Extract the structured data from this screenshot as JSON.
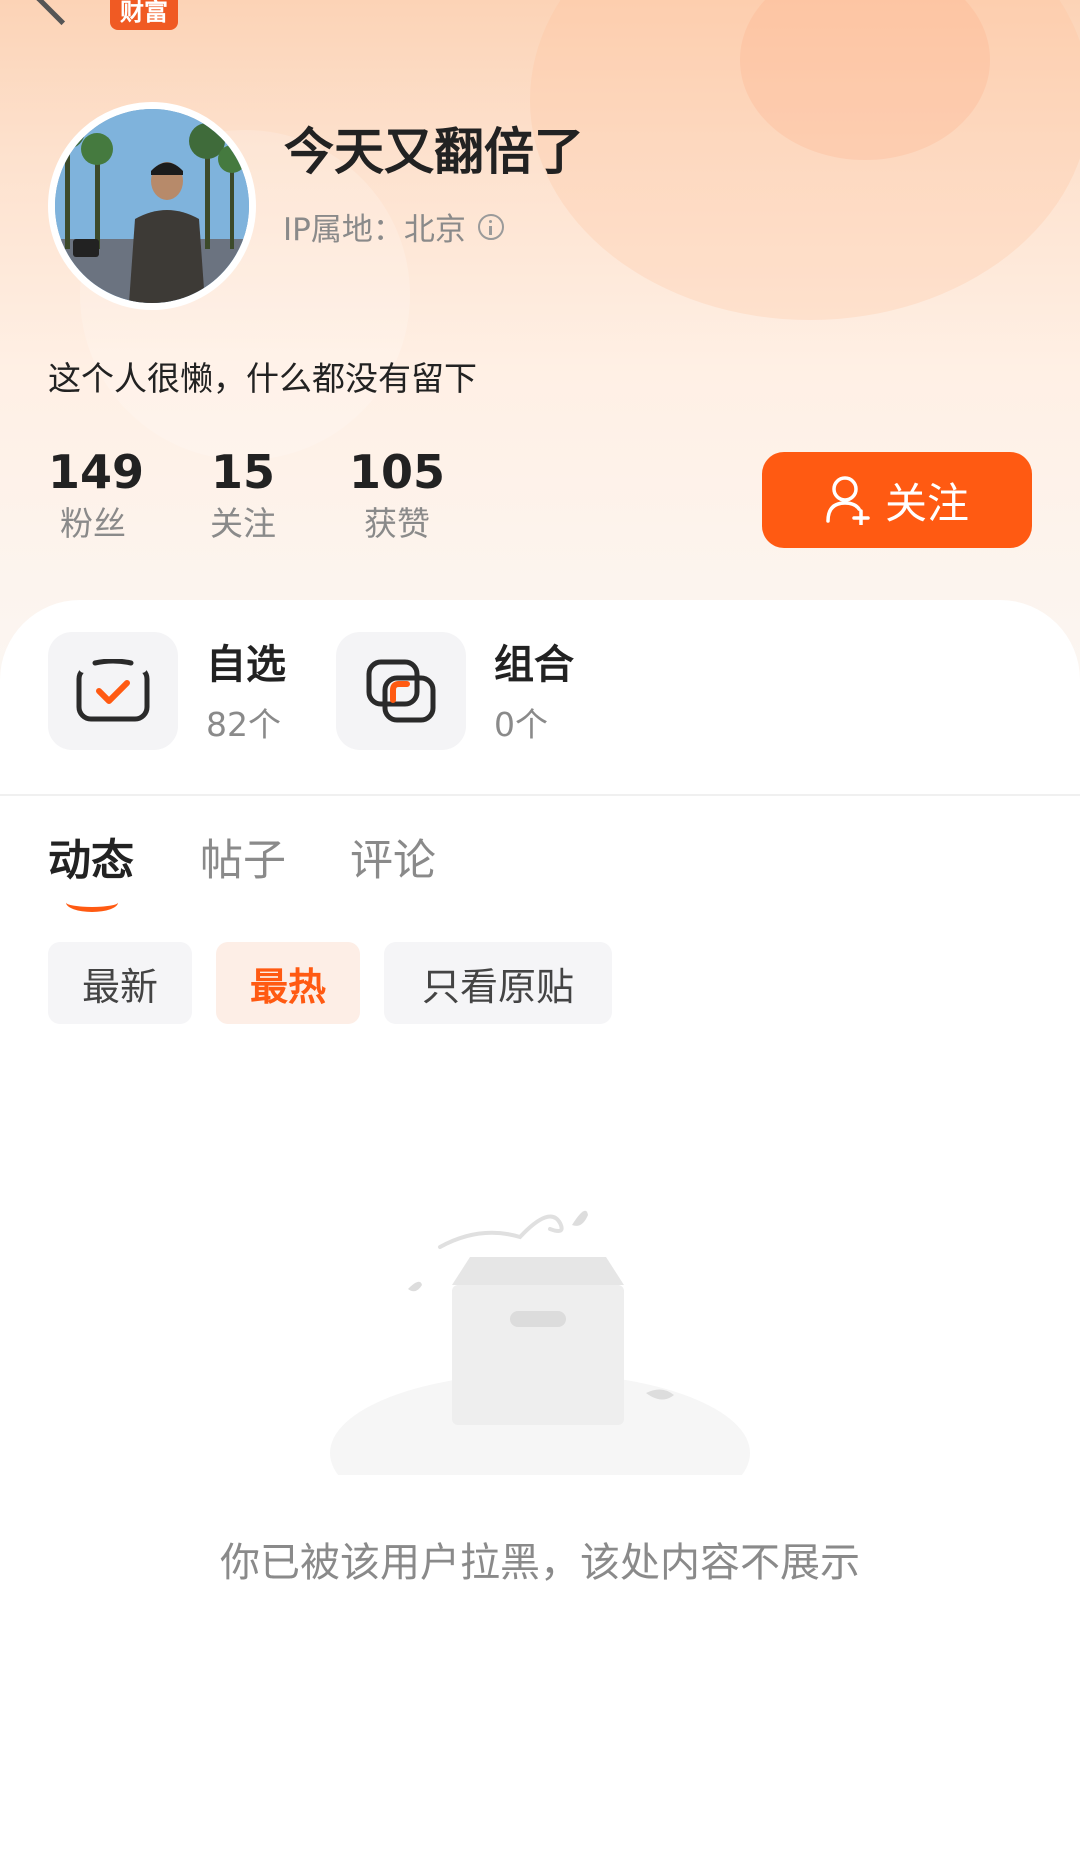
{
  "header": {
    "back_icon": "chevron-left-icon",
    "app_badge": "财富"
  },
  "profile": {
    "username": "今天又翻倍了",
    "ip_location": "IP属地：北京",
    "bio": "这个人很懒，什么都没有留下",
    "stats": [
      {
        "value": "149",
        "label": "粉丝"
      },
      {
        "value": "15",
        "label": "关注"
      },
      {
        "value": "105",
        "label": "获赞"
      }
    ],
    "follow_button": "关注"
  },
  "features": [
    {
      "title": "自选",
      "count": "82个",
      "icon": "watchlist-check-icon"
    },
    {
      "title": "组合",
      "count": "0个",
      "icon": "portfolio-icon"
    }
  ],
  "tabs": [
    {
      "label": "动态",
      "active": true
    },
    {
      "label": "帖子",
      "active": false
    },
    {
      "label": "评论",
      "active": false
    }
  ],
  "filters": [
    {
      "label": "最新",
      "active": false
    },
    {
      "label": "最热",
      "active": true
    },
    {
      "label": "只看原贴",
      "active": false
    }
  ],
  "empty_state": {
    "message": "你已被该用户拉黑，该处内容不展示",
    "icon": "empty-box-icon"
  },
  "colors": {
    "accent": "#ff5a12",
    "hero_top": "#fcd3b6",
    "muted_text": "#8a8a8a"
  }
}
